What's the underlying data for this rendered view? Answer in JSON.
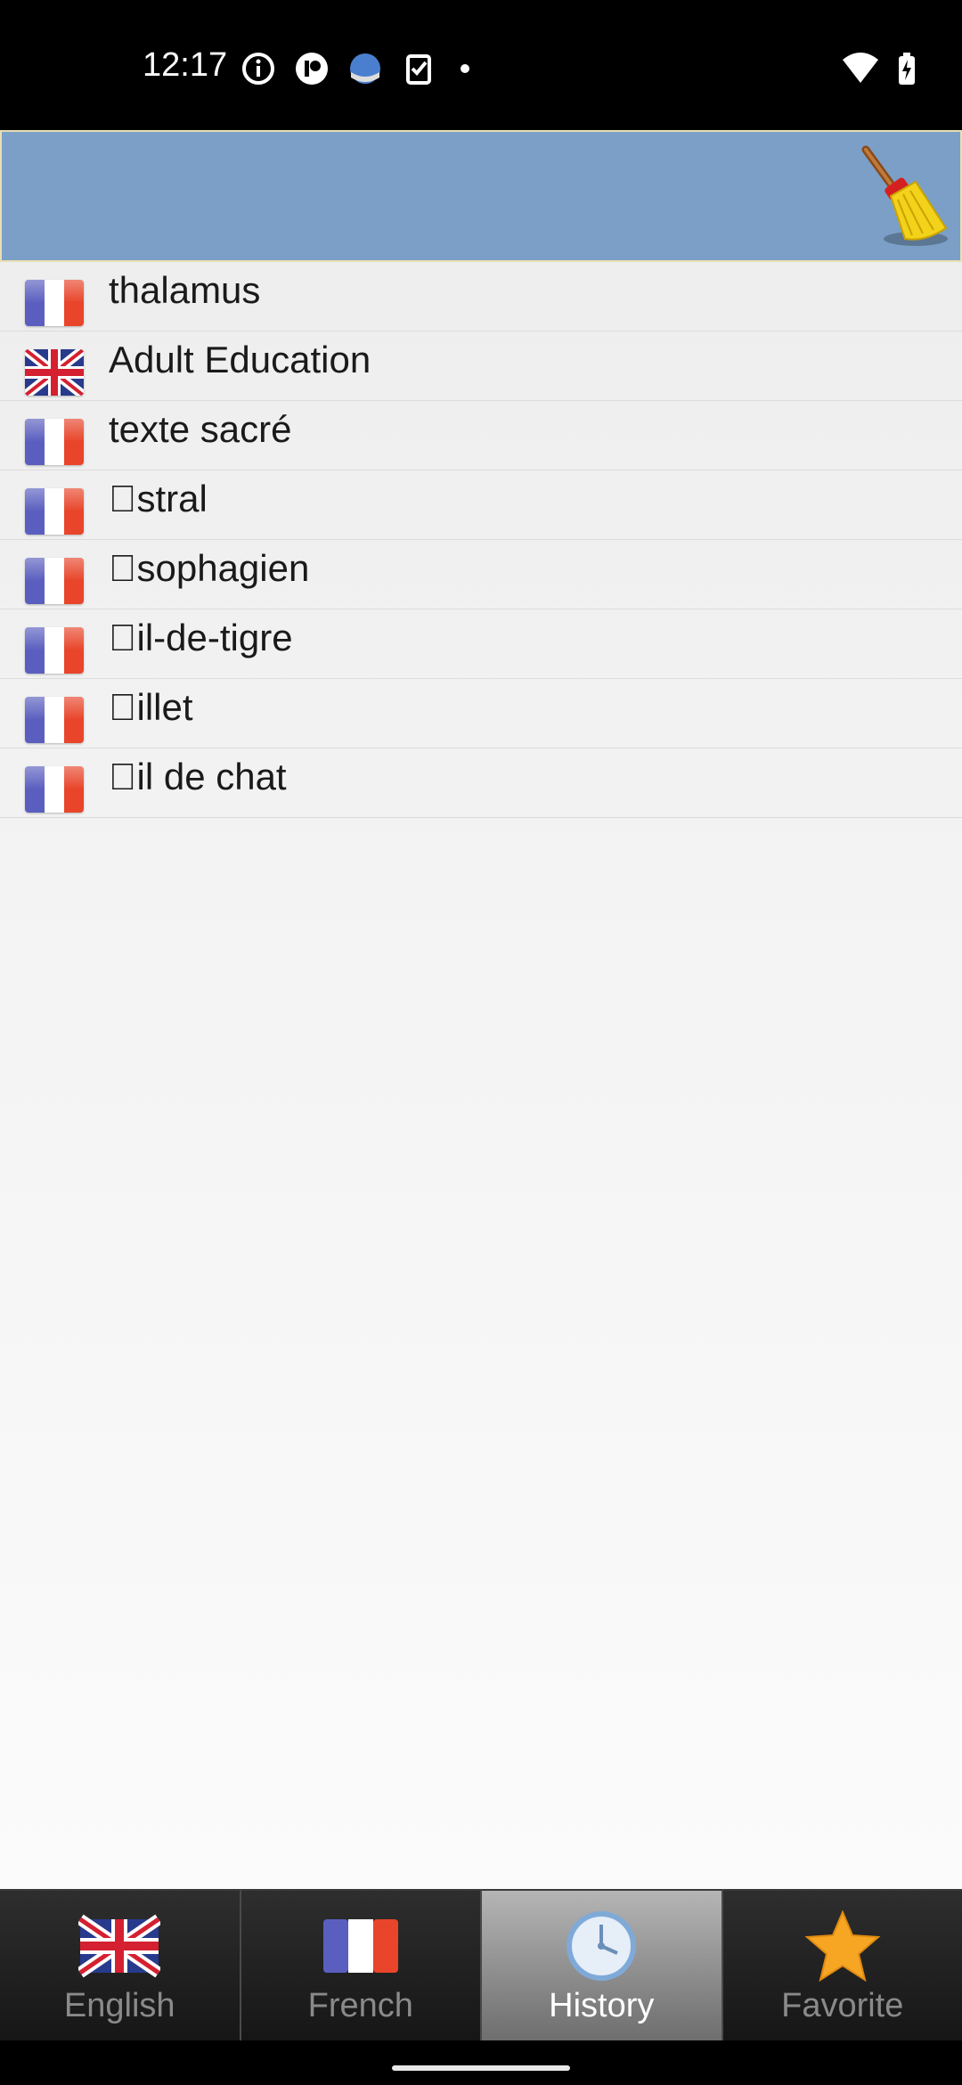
{
  "status_bar": {
    "time": "12:17"
  },
  "header": {
    "clear_icon": "broom-icon"
  },
  "history": [
    {
      "word": "thalamus",
      "flag": "french"
    },
    {
      "word": "Adult Education",
      "flag": "english"
    },
    {
      "word": "texte sacré",
      "flag": "french"
    },
    {
      "word": "\u0000stral",
      "flag": "french"
    },
    {
      "word": "\u0000sophagien",
      "flag": "french"
    },
    {
      "word": "\u0000il-de-tigre",
      "flag": "french"
    },
    {
      "word": "\u0000illet",
      "flag": "french"
    },
    {
      "word": "\u0000il de chat",
      "flag": "french"
    }
  ],
  "tabs": [
    {
      "label": "English",
      "icon": "uk-flag-icon",
      "active": false
    },
    {
      "label": "French",
      "icon": "france-flag-icon",
      "active": false
    },
    {
      "label": "History",
      "icon": "clock-icon",
      "active": true
    },
    {
      "label": "Favorite",
      "icon": "star-icon",
      "active": false
    }
  ]
}
